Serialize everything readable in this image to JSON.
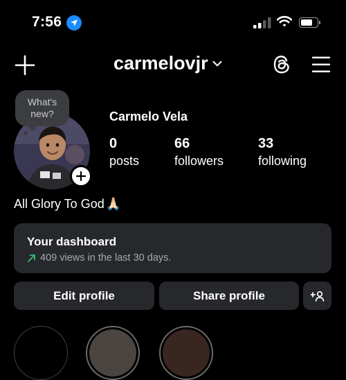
{
  "status_bar": {
    "time": "7:56",
    "location_icon": "location-arrow-icon",
    "signal_icon": "cellular-signal-icon",
    "wifi_icon": "wifi-icon",
    "battery_icon": "battery-icon"
  },
  "header": {
    "username": "carmelovjr",
    "new_post_icon": "plus-icon",
    "switch_account_icon": "chevron-down-icon",
    "threads_icon": "threads-icon",
    "menu_icon": "hamburger-menu-icon"
  },
  "note": {
    "line1": "What's",
    "line2": "new?"
  },
  "profile": {
    "full_name": "Carmelo Vela",
    "bio": "All Glory To God",
    "bio_emoji": "🙏🏻"
  },
  "stats": [
    {
      "value": "0",
      "label": "posts"
    },
    {
      "value": "66",
      "label": "followers"
    },
    {
      "value": "33",
      "label": "following"
    }
  ],
  "dashboard": {
    "title": "Your dashboard",
    "subtitle": "409 views in the last 30 days.",
    "trend_color": "#2fbf71"
  },
  "actions": {
    "edit_profile": "Edit profile",
    "share_profile": "Share profile",
    "add_user_icon": "person-add-icon"
  },
  "colors": {
    "background": "#000000",
    "card": "#26282c",
    "accent_blue": "#1a8cff"
  }
}
